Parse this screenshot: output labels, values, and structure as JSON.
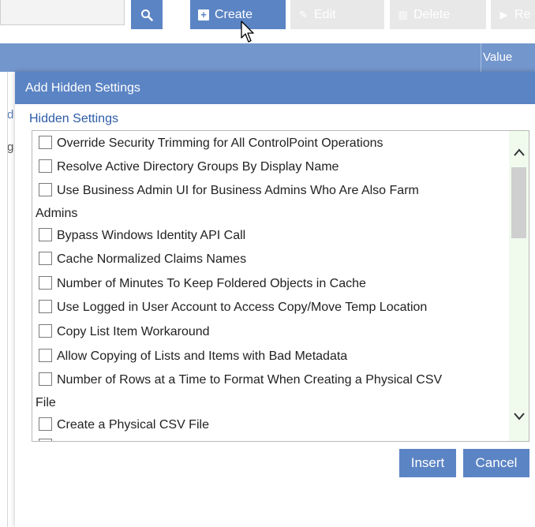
{
  "toolbar": {
    "create_label": "Create",
    "edit_label": "Edit",
    "delete_label": "Delete",
    "re_label": "Re"
  },
  "grid": {
    "value_header": "Value",
    "left_fragment_1": "d",
    "left_fragment_2": "g"
  },
  "dialog": {
    "title": "Add Hidden Settings",
    "section_label": "Hidden Settings",
    "items": [
      {
        "label": "Override Security Trimming for All ControlPoint Operations"
      },
      {
        "label": "Resolve Active Directory Groups By Display Name"
      },
      {
        "label": "Use Business Admin UI for Business Admins Who Are Also Farm",
        "wrap": "Admins"
      },
      {
        "label": "Bypass Windows Identity API Call"
      },
      {
        "label": "Cache Normalized Claims Names"
      },
      {
        "label": "Number of Minutes To Keep Foldered Objects in Cache"
      },
      {
        "label": "Use Logged in User Account to Access Copy/Move Temp Location"
      },
      {
        "label": "Copy List Item Workaround"
      },
      {
        "label": "Allow Copying of Lists and Items with Bad Metadata"
      },
      {
        "label": "Number of Rows at a Time to Format When Creating a Physical CSV",
        "wrap": "File"
      },
      {
        "label": "Create a Physical CSV File"
      }
    ],
    "insert_label": "Insert",
    "cancel_label": "Cancel"
  },
  "icons": {
    "search": "search-icon",
    "create": "plus-square-icon",
    "edit": "pencil-icon",
    "delete": "trash-icon",
    "re": "play-icon",
    "scroll_up": "chevron-up-icon",
    "scroll_down": "chevron-down-icon",
    "cursor": "mouse-pointer-icon"
  },
  "colors": {
    "accent": "#5b84c4",
    "header": "#7396cc",
    "scroll_track": "#f0fbee",
    "disabled_button": "#e8e8e8"
  }
}
